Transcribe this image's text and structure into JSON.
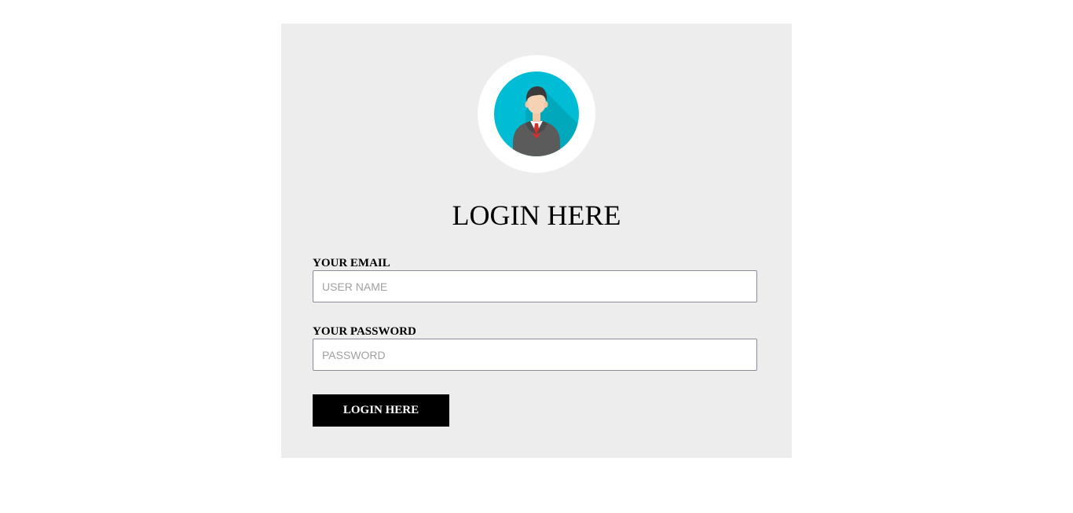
{
  "login": {
    "title": "LOGIN HERE",
    "email_label": "YOUR EMAIL",
    "email_placeholder": "USER NAME",
    "email_value": "",
    "password_label": "YOUR PASSWORD",
    "password_placeholder": "PASSWORD",
    "password_value": "",
    "submit_label": "LOGIN HERE"
  },
  "avatar": {
    "icon": "user-avatar-icon"
  },
  "colors": {
    "card_background": "#ededed",
    "avatar_circle": "#00bcd4",
    "button_background": "#000000",
    "button_text": "#ffffff"
  }
}
